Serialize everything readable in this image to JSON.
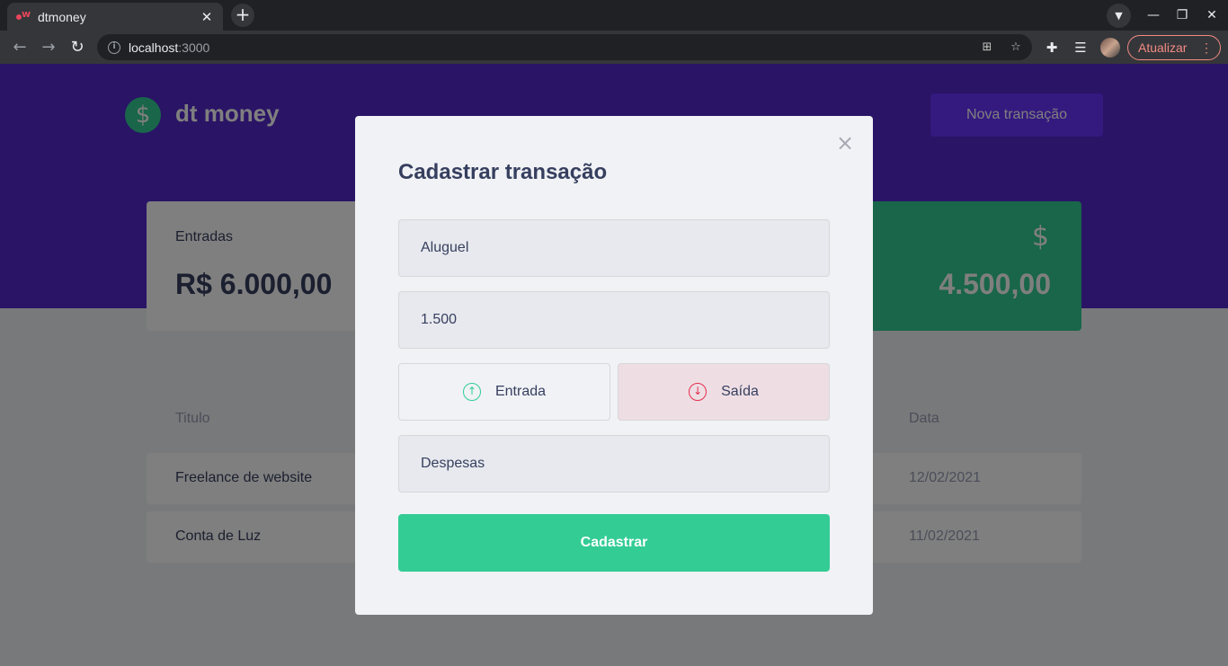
{
  "browser": {
    "tab_title": "dtmoney",
    "url_host": "localhost",
    "url_port": ":3000",
    "update_label": "Atualizar"
  },
  "app": {
    "logo_symbol": "$",
    "logo_text": "dt money",
    "new_transaction_label": "Nova transação"
  },
  "summary": {
    "income": {
      "label": "Entradas",
      "value": "R$ 6.000,00"
    },
    "total": {
      "value": "4.500,00",
      "icon": "$"
    }
  },
  "table": {
    "headers": {
      "title": "Titulo",
      "date": "Data"
    },
    "rows": [
      {
        "title": "Freelance de website",
        "date": "12/02/2021"
      },
      {
        "title": "Conta de Luz",
        "date": "11/02/2021"
      }
    ]
  },
  "modal": {
    "title": "Cadastrar transação",
    "close_symbol": "×",
    "title_field_value": "Aluguel",
    "amount_field_value": "1.500",
    "type_income_label": "Entrada",
    "type_outcome_label": "Saída",
    "category_field_value": "Despesas",
    "submit_label": "Cadastrar"
  },
  "colors": {
    "brand_purple": "#5429cc",
    "button_purple": "#6933ff",
    "green": "#33cc95",
    "red": "#e52e4d",
    "text_title": "#363f5f",
    "text_body": "#969cb3"
  }
}
